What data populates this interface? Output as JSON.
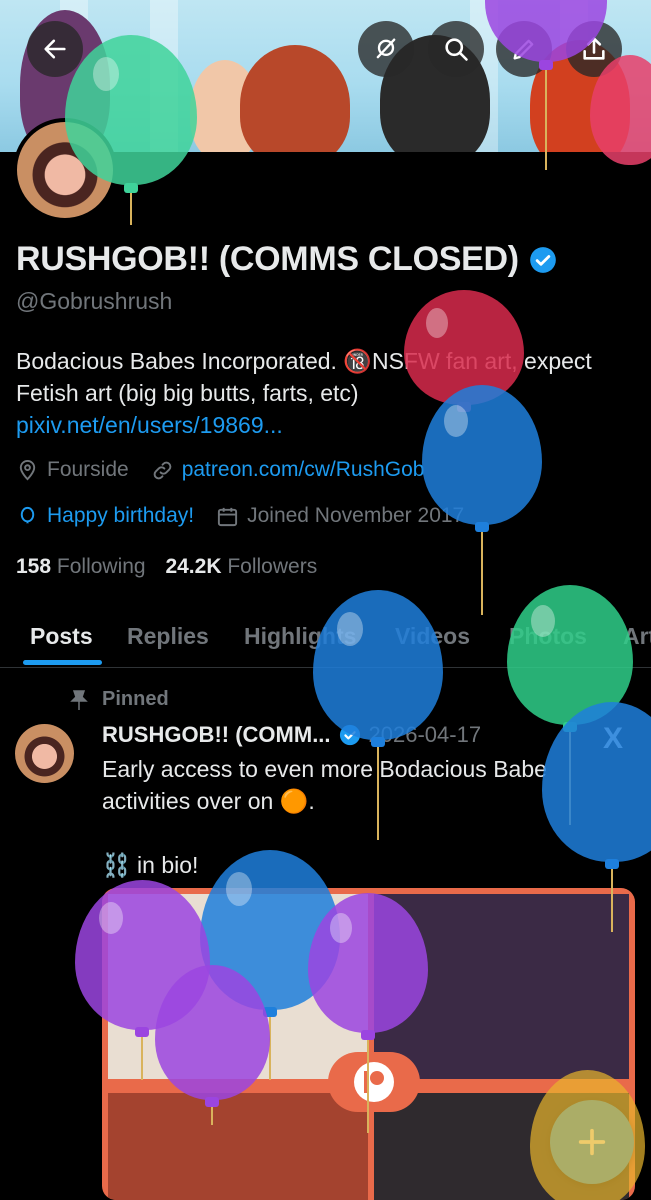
{
  "colors": {
    "background": "#000000",
    "accent": "#1d9bf0",
    "text_primary": "#e7e9ea",
    "text_secondary": "#71767b",
    "divider": "#2f3336"
  },
  "topbar": {
    "back_icon": "arrow-left-icon",
    "actions": [
      "hide-balloons-icon",
      "search-icon",
      "edit-icon",
      "share-icon"
    ]
  },
  "profile": {
    "display_name": "RUSHGOB!! (COMMS CLOSED)",
    "handle": "@Gobrushrush",
    "bio_text": "Bodacious Babes Incorporated. 🔞NSFW fan art, expect Fetish art (big big butts, farts, etc)",
    "bio_link": "pixiv.net/en/users/19869...",
    "location": "Fourside",
    "website": "patreon.com/cw/RushGob",
    "birthday": "Happy birthday!",
    "joined": "Joined November 2017",
    "following_count": "158",
    "following_label": "Following",
    "followers_count": "24.2K",
    "followers_label": "Followers"
  },
  "tabs": [
    {
      "label": "Posts",
      "active": true
    },
    {
      "label": "Replies",
      "active": false
    },
    {
      "label": "Highlights",
      "active": false
    },
    {
      "label": "Videos",
      "active": false
    },
    {
      "label": "Photos",
      "active": false
    },
    {
      "label": "Articles",
      "active": false
    }
  ],
  "post": {
    "pinned_label": "Pinned",
    "author_name": "RUSHGOB!! (COMM...",
    "date": "2026-04-17",
    "text": "Early access to even more Bodacious Babe activities over on 🟠.\n\n⛓️ in bio!"
  },
  "fab_icon": "plus-icon",
  "x_logo": "X"
}
